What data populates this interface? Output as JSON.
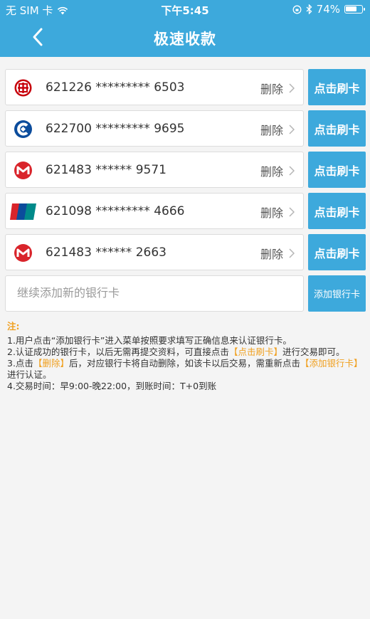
{
  "status_bar": {
    "carrier": "无 SIM 卡",
    "time": "下午5:45",
    "battery": "74%",
    "battery_level": 0.74
  },
  "nav": {
    "title": "极速收款",
    "back_icon": "chevron-left-icon"
  },
  "colors": {
    "accent": "#3da9dc",
    "highlight": "#f0a020"
  },
  "cards": [
    {
      "bank_icon": "icbc-logo-icon",
      "number": "621226 ********* 6503",
      "delete_label": "删除",
      "swipe_label": "点击刷卡"
    },
    {
      "bank_icon": "ccb-logo-icon",
      "number": "622700 ********* 9695",
      "delete_label": "删除",
      "swipe_label": "点击刷卡"
    },
    {
      "bank_icon": "cmb-logo-icon",
      "number": "621483 ****** 9571",
      "delete_label": "删除",
      "swipe_label": "点击刷卡"
    },
    {
      "bank_icon": "unionpay-logo-icon",
      "number": "621098 ********* 4666",
      "delete_label": "删除",
      "swipe_label": "点击刷卡"
    },
    {
      "bank_icon": "cmb-logo-icon",
      "number": "621483 ****** 2663",
      "delete_label": "删除",
      "swipe_label": "点击刷卡"
    }
  ],
  "add_card": {
    "placeholder": "继续添加新的银行卡",
    "button_label": "添加银行卡"
  },
  "notes": {
    "heading": "注:",
    "line1": "1.用户点击“添加银行卡”进入菜单按照要求填写正确信息来认证银行卡。",
    "line2_a": "2.认证成功的银行卡，以后无需再提交资料，可直接点击",
    "line2_hl": "【点击刷卡】",
    "line2_b": "进行交易即可。",
    "line3_a": "3.点击",
    "line3_hl1": "【删除】",
    "line3_b": "后，对应银行卡将自动删除，如该卡以后交易，需重新点击",
    "line3_hl2": "【添加银行卡】",
    "line3_c": "进行认证。",
    "line4": "4.交易时间：早9:00-晚22:00，到账时间：T+0到账"
  }
}
